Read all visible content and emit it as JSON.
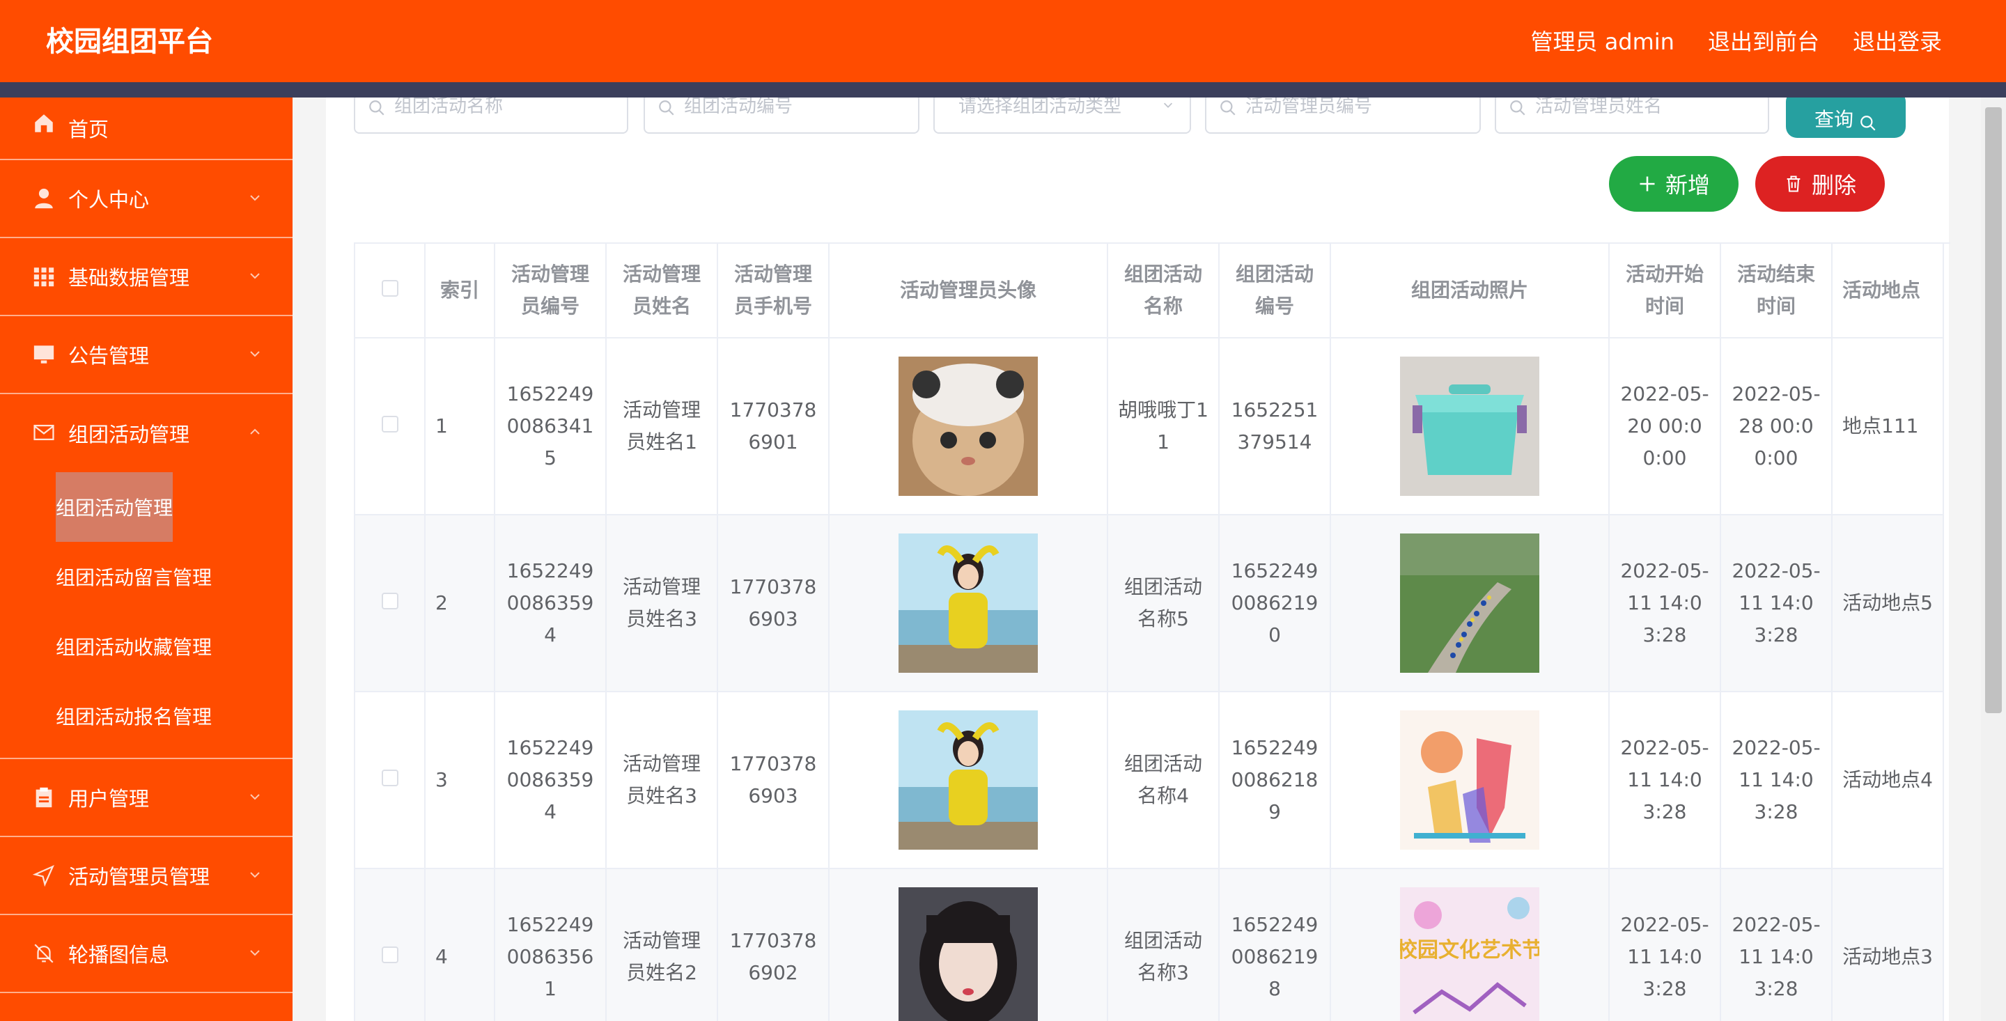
{
  "header": {
    "title": "校园组团平台",
    "admin": "管理员 admin",
    "to_front": "退出到前台",
    "logout": "退出登录"
  },
  "sidebar": {
    "items": [
      {
        "label": "首页",
        "icon": "home-icon"
      },
      {
        "label": "个人中心",
        "icon": "user-icon"
      },
      {
        "label": "基础数据管理",
        "icon": "grid-icon"
      },
      {
        "label": "公告管理",
        "icon": "monitor-icon"
      },
      {
        "label": "组团活动管理",
        "icon": "mail-icon"
      }
    ],
    "submenu": [
      "组团活动管理",
      "组团活动留言管理",
      "组团活动收藏管理",
      "组团活动报名管理"
    ],
    "items_after": [
      {
        "label": "用户管理",
        "icon": "clipboard-icon"
      },
      {
        "label": "活动管理员管理",
        "icon": "navigation-icon"
      },
      {
        "label": "轮播图信息",
        "icon": "bell-off-icon"
      }
    ]
  },
  "search": {
    "activity_name": "组团活动名称",
    "activity_no": "组团活动编号",
    "activity_type": "请选择组团活动类型",
    "manager_no": "活动管理员编号",
    "manager_name": "活动管理员姓名",
    "query": "查询"
  },
  "actions": {
    "add": "新增",
    "delete": "删除"
  },
  "table": {
    "headers": [
      "",
      "索引",
      "活动管理员编号",
      "活动管理员姓名",
      "活动管理员手机号",
      "活动管理员头像",
      "组团活动名称",
      "组团活动编号",
      "组团活动照片",
      "活动开始时间",
      "活动结束时间",
      "活动地点"
    ],
    "rows": [
      {
        "index": "1",
        "mgr_no": "16522490086341 5",
        "mgr_name": "活动管理员姓名1",
        "phone": "17703786901",
        "act_name": "胡哦哦丁11",
        "act_no": "1652251379514",
        "start": "2022-05-20 00:00:00",
        "end": "2022-05-28 00:00:00",
        "place": "地点111"
      },
      {
        "index": "2",
        "mgr_no": "16522490086359 4",
        "mgr_name": "活动管理员姓名3",
        "phone": "17703786903",
        "act_name": "组团活动名称5",
        "act_no": "16522490086219 0",
        "start": "2022-05-11 14:03:28",
        "end": "2022-05-11 14:03:28",
        "place": "活动地点5"
      },
      {
        "index": "3",
        "mgr_no": "16522490086359 4",
        "mgr_name": "活动管理员姓名3",
        "phone": "17703786903",
        "act_name": "组团活动名称4",
        "act_no": "16522490086218 9",
        "start": "2022-05-11 14:03:28",
        "end": "2022-05-11 14:03:28",
        "place": "活动地点4"
      },
      {
        "index": "4",
        "mgr_no": "16522490086356 1",
        "mgr_name": "活动管理员姓名2",
        "phone": "17703786902",
        "act_name": "组团活动名称3",
        "act_no": "16522490086219 8",
        "start": "2022-05-11 14:03:28",
        "end": "2022-05-11 14:03:28",
        "place": "活动地点3"
      }
    ],
    "photo4_text": "校园文化艺术节"
  },
  "colors": {
    "brand": "#ff4c00",
    "add": "#22aa44",
    "delete": "#dd2222",
    "query": "#26a0a0"
  }
}
